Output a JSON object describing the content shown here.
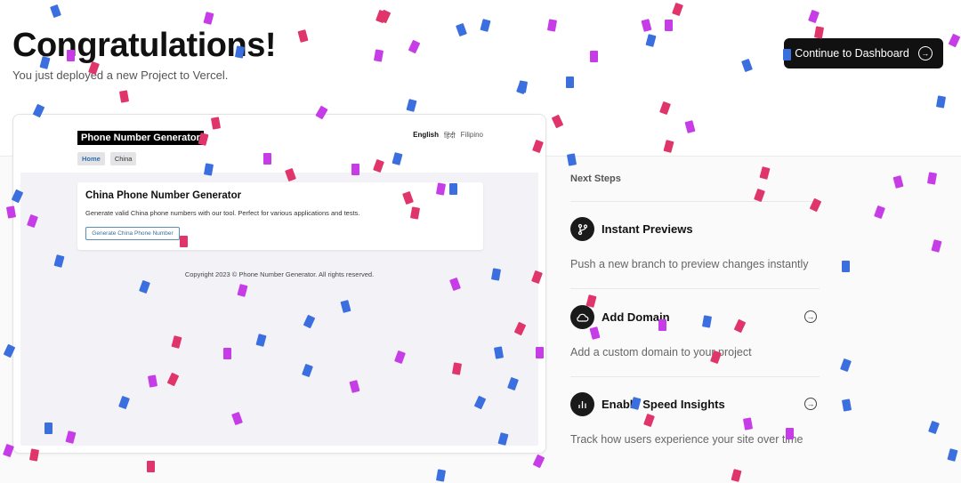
{
  "header": {
    "title": "Congratulations!",
    "subtitle": "You just deployed a new Project to Vercel.",
    "cta_label": "Continue to Dashboard",
    "cta_icon": "arrow-right-circle-icon"
  },
  "preview": {
    "brand": "Phone Number Generator",
    "languages": [
      "English",
      "हिंदी",
      "Filipino"
    ],
    "nav": [
      "Home",
      "China"
    ],
    "card_title": "China Phone Number Generator",
    "card_text": "Generate valid China phone numbers with our tool. Perfect for various applications and tests.",
    "card_button": "Generate China Phone Number",
    "footer": "Copyright 2023 © Phone Number Generator. All rights reserved."
  },
  "next_steps": {
    "heading": "Next Steps",
    "items": [
      {
        "title": "Instant Previews",
        "description": "Push a new branch to preview changes instantly",
        "icon": "git-branch-icon"
      },
      {
        "title": "Add Domain",
        "description": "Add a custom domain to your project",
        "icon": "cloud-icon"
      },
      {
        "title": "Enable Speed Insights",
        "description": "Track how users experience your site over time",
        "icon": "bar-chart-icon"
      }
    ]
  },
  "colors": {
    "confetti": [
      "#3b6fe0",
      "#e0356b",
      "#c63de8"
    ],
    "button_bg": "#111111"
  }
}
